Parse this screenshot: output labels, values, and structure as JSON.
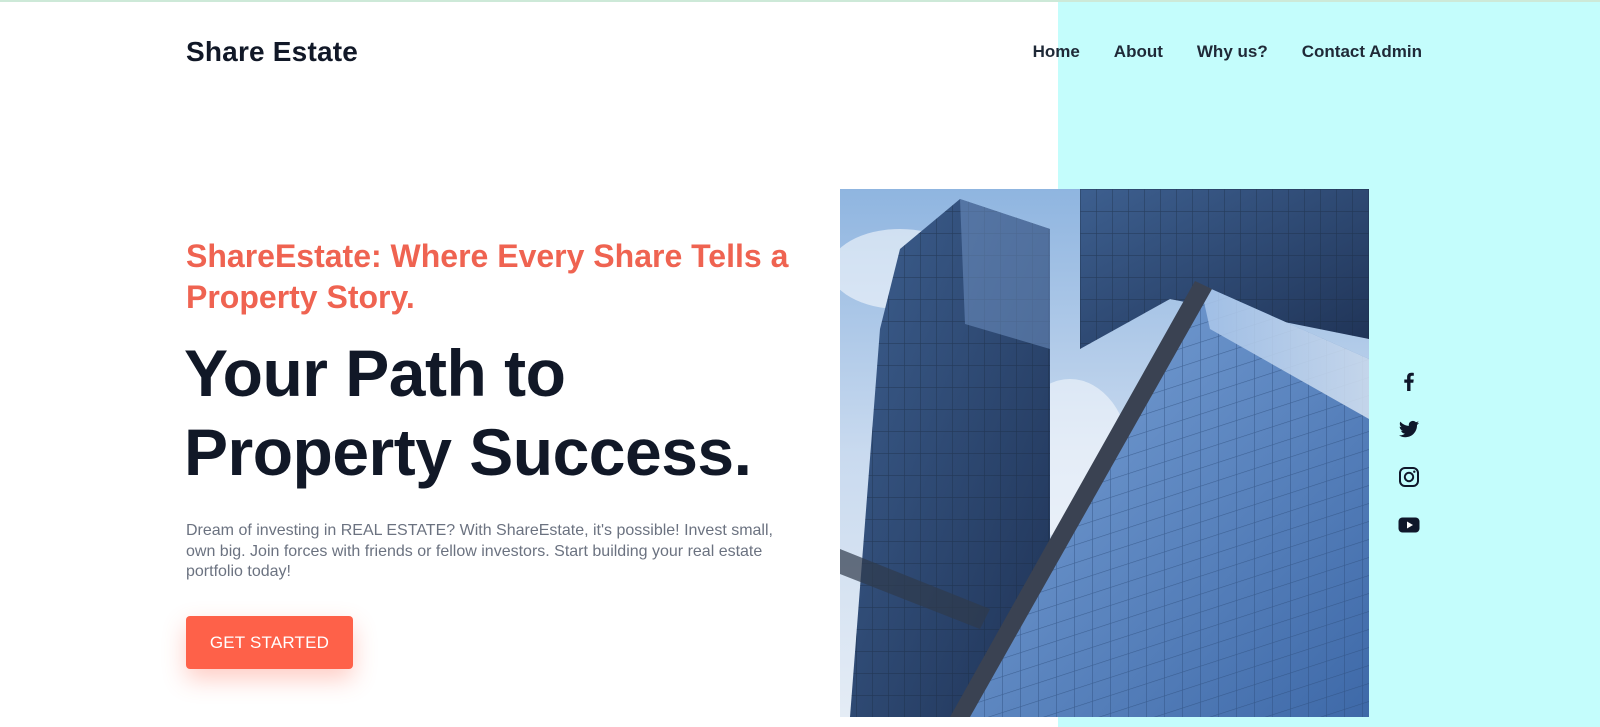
{
  "site": {
    "logo_text": "Share Estate"
  },
  "nav": {
    "items": [
      {
        "label": "Home"
      },
      {
        "label": "About"
      },
      {
        "label": "Why us?"
      },
      {
        "label": "Contact Admin"
      }
    ]
  },
  "hero": {
    "tagline": "ShareEstate: Where Every Share Tells a Property Story.",
    "headline_line1": "Your Path to",
    "headline_line2": "Property Success.",
    "description": "Dream of investing in REAL ESTATE? With ShareEstate, it's possible! Invest small, own big. Join forces with friends or fellow investors. Start building your real estate portfolio today!",
    "cta_label": "GET STARTED",
    "image_subject": "glass skyscrapers photo"
  },
  "social": {
    "icons": [
      "facebook-icon",
      "twitter-icon",
      "instagram-icon",
      "youtube-icon"
    ]
  },
  "colors": {
    "accent": "#fe6149",
    "tagline": "#ef6351",
    "panel": "#c4fdfc",
    "heading": "#111827",
    "body_text": "#6b7280"
  }
}
